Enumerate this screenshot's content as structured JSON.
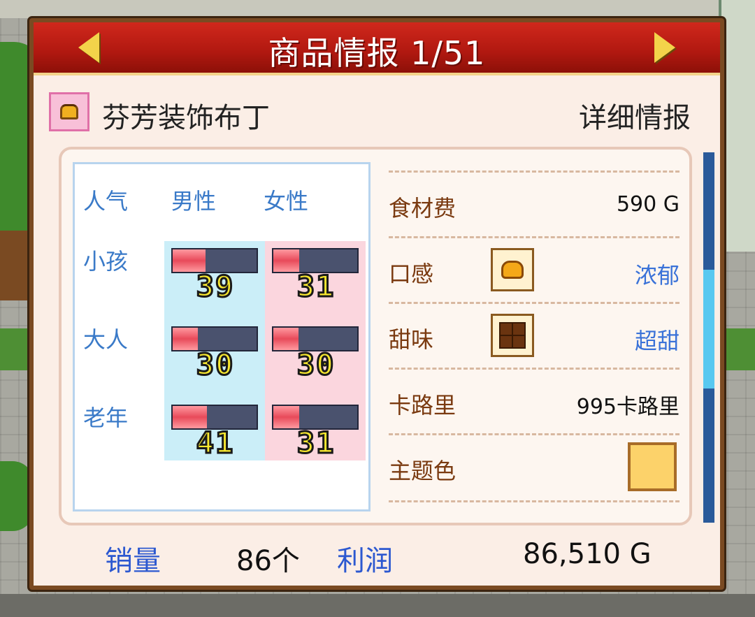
{
  "header": {
    "title": "商品情报 1/51"
  },
  "item": {
    "name": "芬芳装饰布丁",
    "detail_link": "详细情报"
  },
  "popularity": {
    "columns": [
      "人气",
      "男性",
      "女性"
    ],
    "rows": [
      {
        "label": "小孩",
        "male": 39,
        "female": 31
      },
      {
        "label": "大人",
        "male": 30,
        "female": 30
      },
      {
        "label": "老年",
        "male": 41,
        "female": 31
      }
    ],
    "gauge_max": 100
  },
  "stats": {
    "ingredient_cost": {
      "label": "食材费",
      "value": "590 G"
    },
    "texture": {
      "label": "口感",
      "value": "浓郁",
      "icon": "pudding-blob-icon"
    },
    "sweetness": {
      "label": "甜味",
      "value": "超甜",
      "icon": "chocolate-icon"
    },
    "calories": {
      "label": "卡路里",
      "value": "995卡路里"
    },
    "theme_color": {
      "label": "主题色",
      "color": "#fcd26a"
    }
  },
  "footer": {
    "sales_label": "销量",
    "sales_value": "86个",
    "profit_label": "利润",
    "profit_value": "86,510 G"
  },
  "colors": {
    "header_red": "#b01810",
    "accent_blue": "#3a72d8",
    "label_brown": "#7a3a10"
  }
}
